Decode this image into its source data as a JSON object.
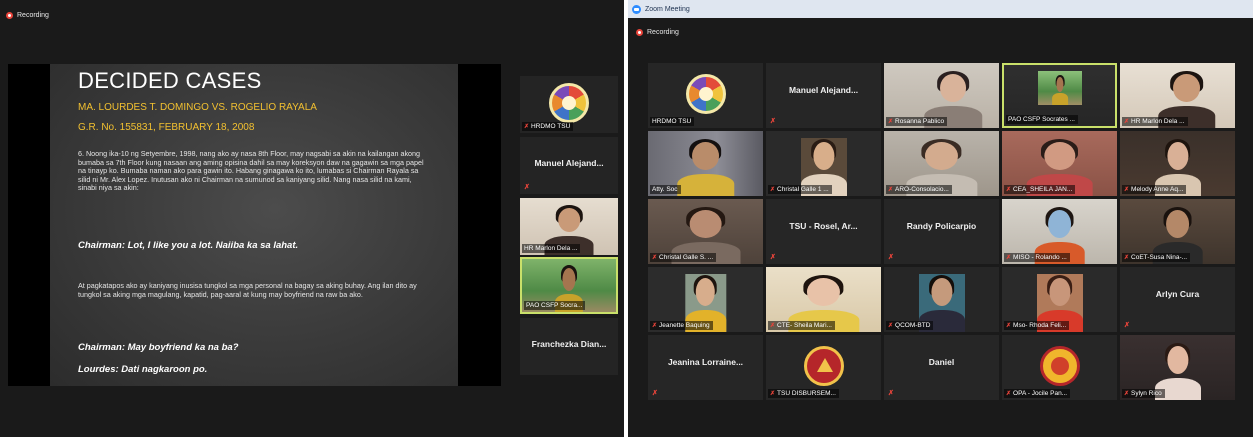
{
  "left_window": {
    "recording_label": "Recording",
    "slide": {
      "title": "DECIDED CASES",
      "case_title": "MA. LOURDES T. DOMINGO VS. ROGELIO RAYALA",
      "gr_number": "G.R. No. 155831, FEBRUARY 18, 2008",
      "paragraph1": "6. Noong ika-10 ng Setyembre, 1998, nang ako ay nasa 8th Floor, may nagsabi sa akin na kailangan akong bumaba sa 7th Floor kung nasaan ang aming opisina dahil sa may koreksyon daw na gagawin sa mga papel na tinayp ko. Bumaba naman ako para gawin ito. Habang ginagawa ko ito, lumabas si Chairman Rayala sa silid ni Mr. Alex Lopez. Inutusan ako ni Chairman na sumunod sa kaniyang silid. Nang nasa silid na kami, sinabi niya sa akin:",
      "quote1": "Chairman: Lot, I like you a lot. Naiiba ka sa lahat.",
      "paragraph2": "At pagkatapos ako ay kaniyang inusisa tungkol sa mga personal na bagay sa aking buhay. Ang ilan dito ay tungkol sa aking mga magulang, kapatid, pag-aaral at kung may boyfriend na raw ba ako.",
      "quote2": "Chairman: May boyfriend ka na ba?",
      "quote3": "Lourdes: Dati nagkaroon po."
    },
    "strip": [
      {
        "label": "HRDMO TSU"
      },
      {
        "name": "Manuel  Alejand..."
      },
      {
        "label": "HR Marlon Dela ..."
      },
      {
        "label": "PAO CSFP Socra..."
      },
      {
        "name": "Franchezka  Dian..."
      }
    ]
  },
  "right_window": {
    "title": "Zoom Meeting",
    "recording_label": "Recording",
    "tiles": [
      {
        "label": "HRDMO TSU"
      },
      {
        "name": "Manuel  Alejand..."
      },
      {
        "label": "Rosanna Pablico"
      },
      {
        "label": "PAO CSFP Socrates ..."
      },
      {
        "label": "HR Marlon Dela ..."
      },
      {
        "label": "Atty. Soc"
      },
      {
        "label": "Christal Galle 1 ..."
      },
      {
        "label": "ARO-Consolacio..."
      },
      {
        "label": "CEA_SHEILA JAN..."
      },
      {
        "label": "Melody Anne Aq..."
      },
      {
        "label": "Christal Galle S. ..."
      },
      {
        "name": "TSU - Rosel, Ar..."
      },
      {
        "name": "Randy Policarpio"
      },
      {
        "label": "MISO - Rolando ..."
      },
      {
        "label": "CoET-Susa Nina-..."
      },
      {
        "label": "Jeanette Baquing"
      },
      {
        "label": "CTE- Sheila Mari..."
      },
      {
        "label": "QCOM-BTD"
      },
      {
        "label": "Mso- Rhoda Feli..."
      },
      {
        "name": "Arlyn Cura"
      },
      {
        "name": "Jeanina  Lorraine..."
      },
      {
        "label": "TSU DISBURSEM..."
      },
      {
        "name": "Daniel"
      },
      {
        "label": "OPA - Jocile Pan..."
      },
      {
        "label": "Sylyn Rico"
      }
    ]
  },
  "colors": {
    "window_bg": "#1a1a1a",
    "tile_bg": "#262626",
    "active_speaker_border": "#c9e06a",
    "muted_icon": "#e8443a",
    "slide_accent": "#f2c030",
    "zoom_blue": "#2d8cff"
  },
  "icons": {
    "recording": "recording-dot-icon",
    "muted": "mic-muted-icon",
    "app": "zoom-app-icon"
  }
}
